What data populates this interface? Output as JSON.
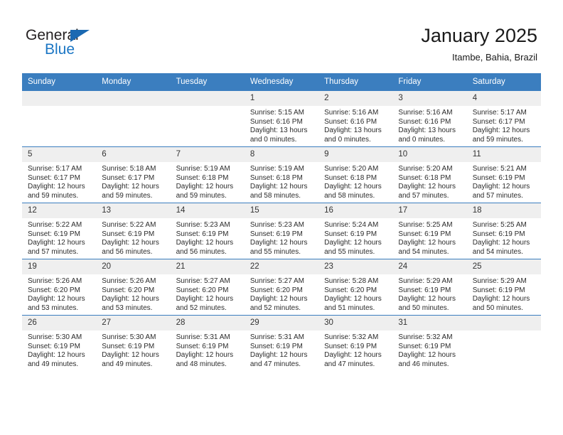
{
  "brand": {
    "name_dark": "General",
    "name_blue": "Blue",
    "accent_color": "#1b69b2",
    "blue_text_color": "#1b76c4"
  },
  "header": {
    "title": "January 2025",
    "subtitle": "Itambe, Bahia, Brazil"
  },
  "theme": {
    "header_row_bg": "#3b7ebf",
    "daynum_bg": "#efefef",
    "row_divider": "#3b7ebf"
  },
  "weekdays": [
    "Sunday",
    "Monday",
    "Tuesday",
    "Wednesday",
    "Thursday",
    "Friday",
    "Saturday"
  ],
  "weeks": [
    [
      {
        "day": "",
        "sunrise": "",
        "sunset": "",
        "daylight_1": "",
        "daylight_2": ""
      },
      {
        "day": "",
        "sunrise": "",
        "sunset": "",
        "daylight_1": "",
        "daylight_2": ""
      },
      {
        "day": "",
        "sunrise": "",
        "sunset": "",
        "daylight_1": "",
        "daylight_2": ""
      },
      {
        "day": "1",
        "sunrise": "Sunrise: 5:15 AM",
        "sunset": "Sunset: 6:16 PM",
        "daylight_1": "Daylight: 13 hours",
        "daylight_2": "and 0 minutes."
      },
      {
        "day": "2",
        "sunrise": "Sunrise: 5:16 AM",
        "sunset": "Sunset: 6:16 PM",
        "daylight_1": "Daylight: 13 hours",
        "daylight_2": "and 0 minutes."
      },
      {
        "day": "3",
        "sunrise": "Sunrise: 5:16 AM",
        "sunset": "Sunset: 6:16 PM",
        "daylight_1": "Daylight: 13 hours",
        "daylight_2": "and 0 minutes."
      },
      {
        "day": "4",
        "sunrise": "Sunrise: 5:17 AM",
        "sunset": "Sunset: 6:17 PM",
        "daylight_1": "Daylight: 12 hours",
        "daylight_2": "and 59 minutes."
      }
    ],
    [
      {
        "day": "5",
        "sunrise": "Sunrise: 5:17 AM",
        "sunset": "Sunset: 6:17 PM",
        "daylight_1": "Daylight: 12 hours",
        "daylight_2": "and 59 minutes."
      },
      {
        "day": "6",
        "sunrise": "Sunrise: 5:18 AM",
        "sunset": "Sunset: 6:17 PM",
        "daylight_1": "Daylight: 12 hours",
        "daylight_2": "and 59 minutes."
      },
      {
        "day": "7",
        "sunrise": "Sunrise: 5:19 AM",
        "sunset": "Sunset: 6:18 PM",
        "daylight_1": "Daylight: 12 hours",
        "daylight_2": "and 59 minutes."
      },
      {
        "day": "8",
        "sunrise": "Sunrise: 5:19 AM",
        "sunset": "Sunset: 6:18 PM",
        "daylight_1": "Daylight: 12 hours",
        "daylight_2": "and 58 minutes."
      },
      {
        "day": "9",
        "sunrise": "Sunrise: 5:20 AM",
        "sunset": "Sunset: 6:18 PM",
        "daylight_1": "Daylight: 12 hours",
        "daylight_2": "and 58 minutes."
      },
      {
        "day": "10",
        "sunrise": "Sunrise: 5:20 AM",
        "sunset": "Sunset: 6:18 PM",
        "daylight_1": "Daylight: 12 hours",
        "daylight_2": "and 57 minutes."
      },
      {
        "day": "11",
        "sunrise": "Sunrise: 5:21 AM",
        "sunset": "Sunset: 6:19 PM",
        "daylight_1": "Daylight: 12 hours",
        "daylight_2": "and 57 minutes."
      }
    ],
    [
      {
        "day": "12",
        "sunrise": "Sunrise: 5:22 AM",
        "sunset": "Sunset: 6:19 PM",
        "daylight_1": "Daylight: 12 hours",
        "daylight_2": "and 57 minutes."
      },
      {
        "day": "13",
        "sunrise": "Sunrise: 5:22 AM",
        "sunset": "Sunset: 6:19 PM",
        "daylight_1": "Daylight: 12 hours",
        "daylight_2": "and 56 minutes."
      },
      {
        "day": "14",
        "sunrise": "Sunrise: 5:23 AM",
        "sunset": "Sunset: 6:19 PM",
        "daylight_1": "Daylight: 12 hours",
        "daylight_2": "and 56 minutes."
      },
      {
        "day": "15",
        "sunrise": "Sunrise: 5:23 AM",
        "sunset": "Sunset: 6:19 PM",
        "daylight_1": "Daylight: 12 hours",
        "daylight_2": "and 55 minutes."
      },
      {
        "day": "16",
        "sunrise": "Sunrise: 5:24 AM",
        "sunset": "Sunset: 6:19 PM",
        "daylight_1": "Daylight: 12 hours",
        "daylight_2": "and 55 minutes."
      },
      {
        "day": "17",
        "sunrise": "Sunrise: 5:25 AM",
        "sunset": "Sunset: 6:19 PM",
        "daylight_1": "Daylight: 12 hours",
        "daylight_2": "and 54 minutes."
      },
      {
        "day": "18",
        "sunrise": "Sunrise: 5:25 AM",
        "sunset": "Sunset: 6:19 PM",
        "daylight_1": "Daylight: 12 hours",
        "daylight_2": "and 54 minutes."
      }
    ],
    [
      {
        "day": "19",
        "sunrise": "Sunrise: 5:26 AM",
        "sunset": "Sunset: 6:20 PM",
        "daylight_1": "Daylight: 12 hours",
        "daylight_2": "and 53 minutes."
      },
      {
        "day": "20",
        "sunrise": "Sunrise: 5:26 AM",
        "sunset": "Sunset: 6:20 PM",
        "daylight_1": "Daylight: 12 hours",
        "daylight_2": "and 53 minutes."
      },
      {
        "day": "21",
        "sunrise": "Sunrise: 5:27 AM",
        "sunset": "Sunset: 6:20 PM",
        "daylight_1": "Daylight: 12 hours",
        "daylight_2": "and 52 minutes."
      },
      {
        "day": "22",
        "sunrise": "Sunrise: 5:27 AM",
        "sunset": "Sunset: 6:20 PM",
        "daylight_1": "Daylight: 12 hours",
        "daylight_2": "and 52 minutes."
      },
      {
        "day": "23",
        "sunrise": "Sunrise: 5:28 AM",
        "sunset": "Sunset: 6:20 PM",
        "daylight_1": "Daylight: 12 hours",
        "daylight_2": "and 51 minutes."
      },
      {
        "day": "24",
        "sunrise": "Sunrise: 5:29 AM",
        "sunset": "Sunset: 6:19 PM",
        "daylight_1": "Daylight: 12 hours",
        "daylight_2": "and 50 minutes."
      },
      {
        "day": "25",
        "sunrise": "Sunrise: 5:29 AM",
        "sunset": "Sunset: 6:19 PM",
        "daylight_1": "Daylight: 12 hours",
        "daylight_2": "and 50 minutes."
      }
    ],
    [
      {
        "day": "26",
        "sunrise": "Sunrise: 5:30 AM",
        "sunset": "Sunset: 6:19 PM",
        "daylight_1": "Daylight: 12 hours",
        "daylight_2": "and 49 minutes."
      },
      {
        "day": "27",
        "sunrise": "Sunrise: 5:30 AM",
        "sunset": "Sunset: 6:19 PM",
        "daylight_1": "Daylight: 12 hours",
        "daylight_2": "and 49 minutes."
      },
      {
        "day": "28",
        "sunrise": "Sunrise: 5:31 AM",
        "sunset": "Sunset: 6:19 PM",
        "daylight_1": "Daylight: 12 hours",
        "daylight_2": "and 48 minutes."
      },
      {
        "day": "29",
        "sunrise": "Sunrise: 5:31 AM",
        "sunset": "Sunset: 6:19 PM",
        "daylight_1": "Daylight: 12 hours",
        "daylight_2": "and 47 minutes."
      },
      {
        "day": "30",
        "sunrise": "Sunrise: 5:32 AM",
        "sunset": "Sunset: 6:19 PM",
        "daylight_1": "Daylight: 12 hours",
        "daylight_2": "and 47 minutes."
      },
      {
        "day": "31",
        "sunrise": "Sunrise: 5:32 AM",
        "sunset": "Sunset: 6:19 PM",
        "daylight_1": "Daylight: 12 hours",
        "daylight_2": "and 46 minutes."
      },
      {
        "day": "",
        "sunrise": "",
        "sunset": "",
        "daylight_1": "",
        "daylight_2": ""
      }
    ]
  ]
}
